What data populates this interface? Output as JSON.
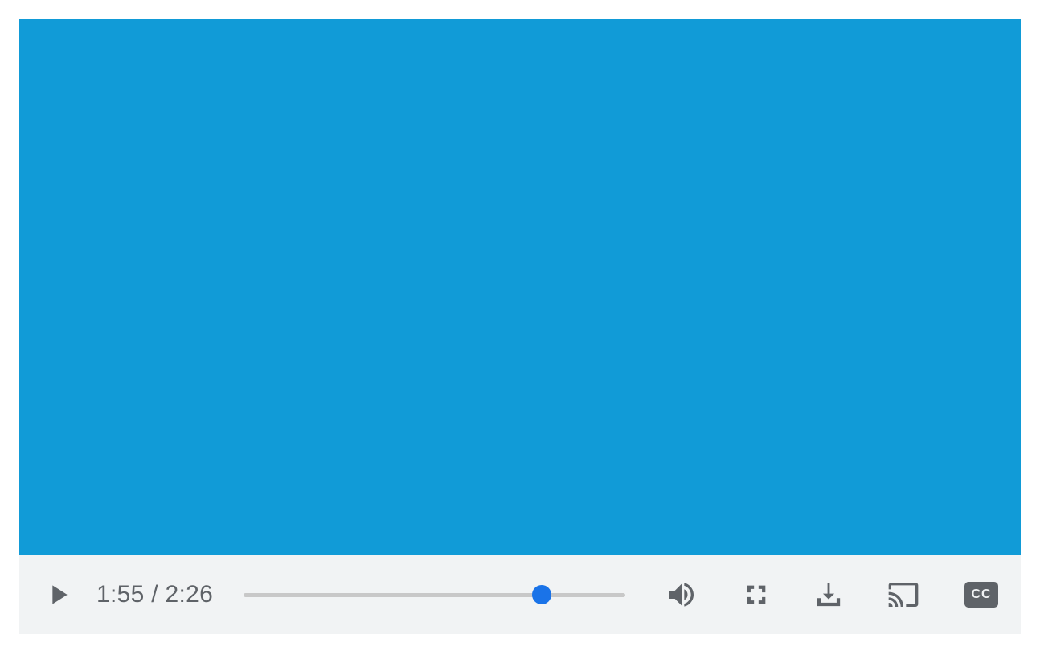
{
  "player": {
    "surface_color": "#119bd7",
    "controls_bg": "#f1f3f4",
    "icon_color": "#5f6368",
    "accent_color": "#1a73e8",
    "current_time": "1:55",
    "duration": "2:26",
    "time_separator": " / ",
    "progress_percent": 78,
    "icons": {
      "play": "play-icon",
      "volume": "volume-icon",
      "fullscreen": "fullscreen-icon",
      "download": "download-icon",
      "cast": "cast-icon",
      "captions": "closed-captions-icon"
    },
    "captions_label": "CC"
  }
}
